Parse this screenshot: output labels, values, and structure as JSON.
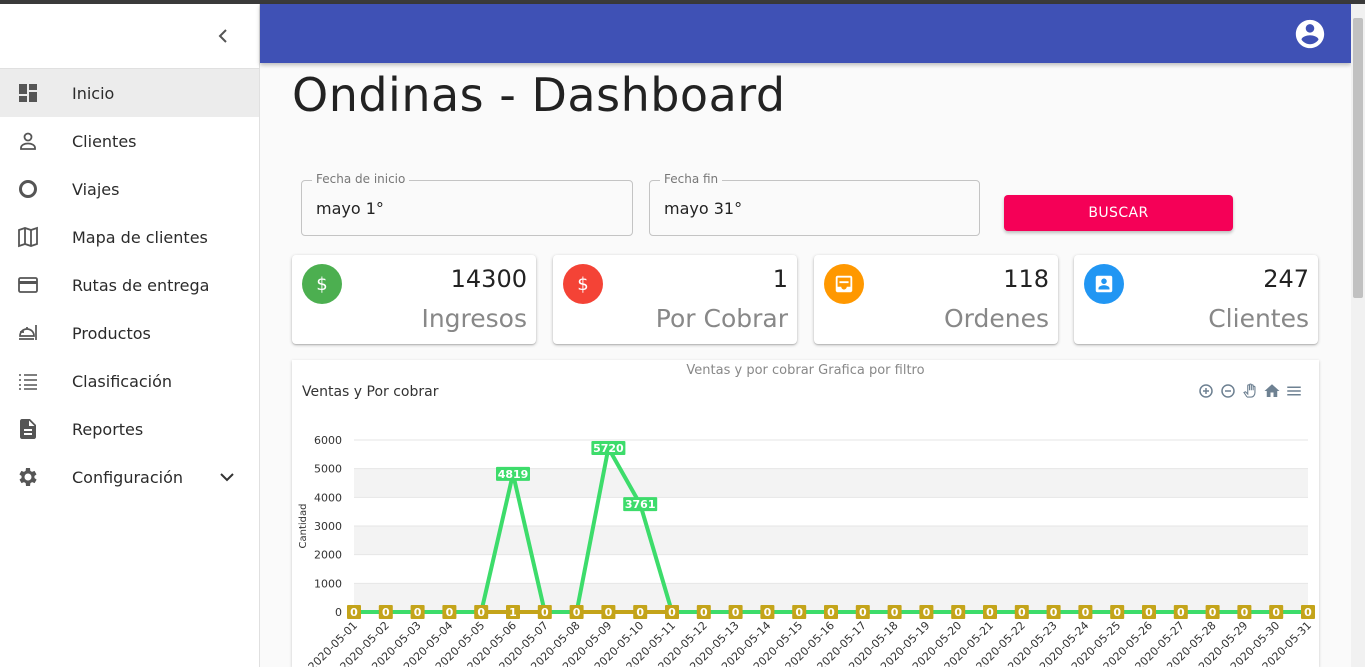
{
  "sidebar": {
    "items": [
      {
        "label": "Inicio",
        "icon": "dashboard-icon",
        "active": true
      },
      {
        "label": "Clientes",
        "icon": "person-icon"
      },
      {
        "label": "Viajes",
        "icon": "circle-icon"
      },
      {
        "label": "Mapa de clientes",
        "icon": "map-icon"
      },
      {
        "label": "Rutas de entrega",
        "icon": "credit-card-icon"
      },
      {
        "label": "Productos",
        "icon": "food-tray-icon"
      },
      {
        "label": "Clasificación",
        "icon": "list-icon"
      },
      {
        "label": "Reportes",
        "icon": "document-icon"
      },
      {
        "label": "Configuración",
        "icon": "gear-icon"
      }
    ]
  },
  "header": {
    "title": "Ondinas - Dashboard"
  },
  "filters": {
    "start_label": "Fecha de inicio",
    "start_value": "mayo 1°",
    "end_label": "Fecha fin",
    "end_value": "mayo 31°",
    "search_label": "BUSCAR"
  },
  "stats": [
    {
      "value": "14300",
      "label": "Ingresos",
      "color": "#4caf50",
      "icon": "dollar-icon"
    },
    {
      "value": "1",
      "label": "Por Cobrar",
      "color": "#f44336",
      "icon": "dollar-icon"
    },
    {
      "value": "118",
      "label": "Ordenes",
      "color": "#ff9800",
      "icon": "inbox-icon"
    },
    {
      "value": "247",
      "label": "Clientes",
      "color": "#2196f3",
      "icon": "contact-icon"
    }
  ],
  "chart_panel": {
    "subtitle": "Ventas y por cobrar Grafica por filtro",
    "title": "Ventas y Por cobrar"
  },
  "chart_data": {
    "type": "line",
    "ylabel": "Cantidad",
    "ylim": [
      0,
      6000
    ],
    "yticks": [
      0,
      1000,
      2000,
      3000,
      4000,
      5000,
      6000
    ],
    "categories": [
      "2020-05-01",
      "2020-05-02",
      "2020-05-03",
      "2020-05-04",
      "2020-05-05",
      "2020-05-06",
      "2020-05-07",
      "2020-05-08",
      "2020-05-09",
      "2020-05-10",
      "2020-05-11",
      "2020-05-12",
      "2020-05-13",
      "2020-05-14",
      "2020-05-15",
      "2020-05-16",
      "2020-05-17",
      "2020-05-18",
      "2020-05-19",
      "2020-05-20",
      "2020-05-21",
      "2020-05-22",
      "2020-05-23",
      "2020-05-24",
      "2020-05-25",
      "2020-05-26",
      "2020-05-27",
      "2020-05-28",
      "2020-05-29",
      "2020-05-30",
      "2020-05-31"
    ],
    "series": [
      {
        "values": [
          0,
          0,
          0,
          0,
          0,
          4819,
          0,
          0,
          5720,
          3761,
          0,
          0,
          0,
          0,
          0,
          0,
          0,
          0,
          0,
          0,
          0,
          0,
          0,
          0,
          0,
          0,
          0,
          0,
          0,
          0,
          0
        ],
        "color": "#3ddc6b"
      },
      {
        "values": [
          0,
          0,
          0,
          0,
          0,
          1,
          0,
          0,
          0,
          0,
          0,
          0,
          0,
          0,
          0,
          0,
          0,
          0,
          0,
          0,
          0,
          0,
          0,
          0,
          0,
          0,
          0,
          0,
          0,
          0,
          0
        ],
        "color": "#c4a41a"
      }
    ],
    "grid": true,
    "data_labels": true
  }
}
